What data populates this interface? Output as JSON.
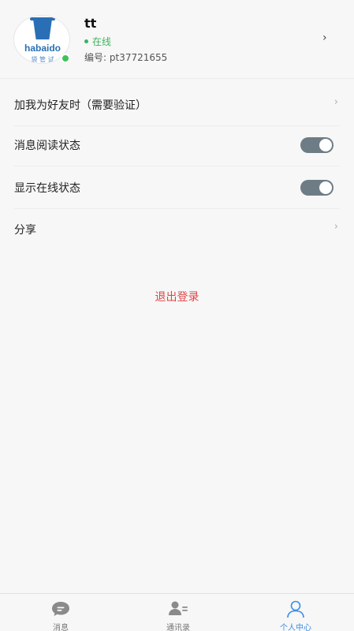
{
  "profile": {
    "name": "tt",
    "status": "在线",
    "id_text": "编号: pt37721655",
    "avatar_brand": "habaido",
    "avatar_brand_sub": "袋 管 试"
  },
  "settings": [
    {
      "label": "加我为好友时（需要验证）",
      "type": "link"
    },
    {
      "label": "消息阅读状态",
      "type": "toggle",
      "on": true
    },
    {
      "label": "显示在线状态",
      "type": "toggle",
      "on": true
    },
    {
      "label": "分享",
      "type": "link"
    }
  ],
  "logout_label": "退出登录",
  "tabs": [
    {
      "label": "消息",
      "icon": "chat-bubble-icon",
      "active": false
    },
    {
      "label": "通讯录",
      "icon": "contacts-icon",
      "active": false
    },
    {
      "label": "个人中心",
      "icon": "person-icon",
      "active": true
    }
  ],
  "colors": {
    "accent": "#3a8ee6",
    "online": "#3cb35a",
    "logout": "#e04444",
    "toggle_on": "#6e7c86"
  }
}
